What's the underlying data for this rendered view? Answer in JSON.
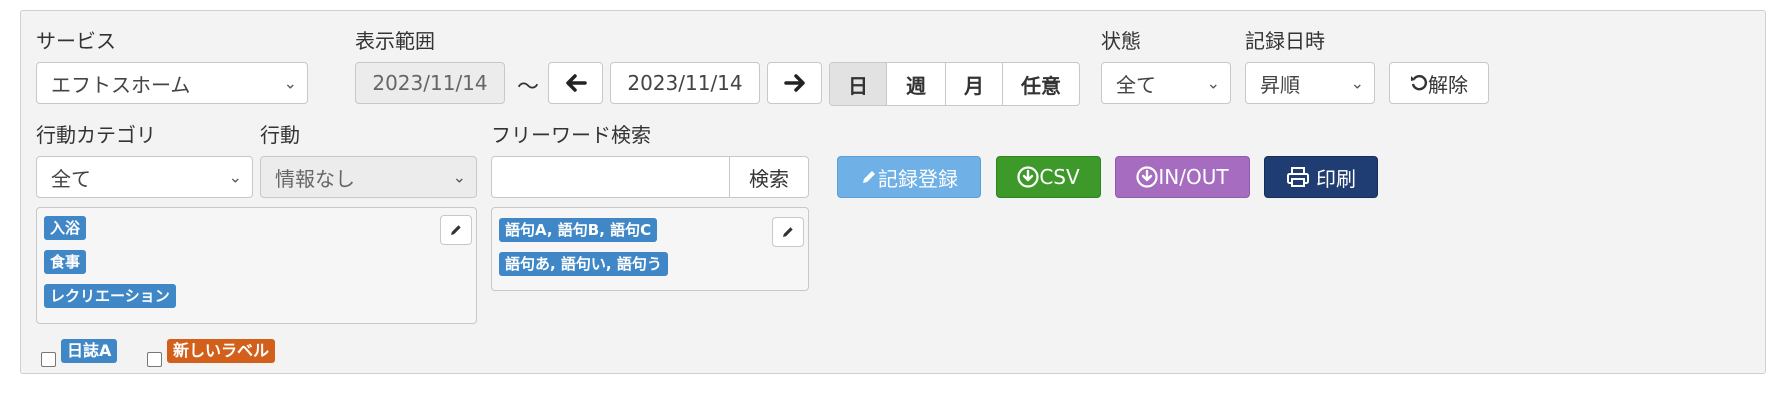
{
  "labels": {
    "service": "サービス",
    "display_range": "表示範囲",
    "status": "状態",
    "record_datetime": "記録日時",
    "action_category": "行動カテゴリ",
    "action": "行動",
    "freeword": "フリーワード検索"
  },
  "service_select": {
    "value": "エフトスホーム"
  },
  "date_range": {
    "start": "2023/11/14",
    "tilde": "～",
    "end": "2023/11/14"
  },
  "period_tabs": [
    {
      "label": "日",
      "active": true
    },
    {
      "label": "週",
      "active": false
    },
    {
      "label": "月",
      "active": false
    },
    {
      "label": "任意",
      "active": false
    }
  ],
  "status_select": {
    "value": "全て"
  },
  "order_select": {
    "value": "昇順"
  },
  "reset_button": {
    "label": "解除"
  },
  "category_select": {
    "value": "全て"
  },
  "action_select": {
    "value": "情報なし"
  },
  "search": {
    "value": "",
    "placeholder": "",
    "button_label": "検索"
  },
  "category_tags": [
    "入浴",
    "食事",
    "レクリエーション"
  ],
  "keyword_tags": [
    "語句A, 語句B, 語句C",
    "語句あ, 語句い, 語句う"
  ],
  "buttons": {
    "register": "記録登録",
    "csv": "CSV",
    "inout": "IN/OUT",
    "print": "印刷"
  },
  "label_filters": [
    {
      "label": "日誌A",
      "color": "#3f87c6",
      "checked": false
    },
    {
      "label": "新しいラベル",
      "color": "#d2601a",
      "checked": false
    }
  ],
  "colors": {
    "register": "#6fb1e6",
    "csv": "#3d9a2a",
    "inout": "#a66cc0",
    "print": "#1f3d72",
    "tag": "#3f87c6"
  }
}
